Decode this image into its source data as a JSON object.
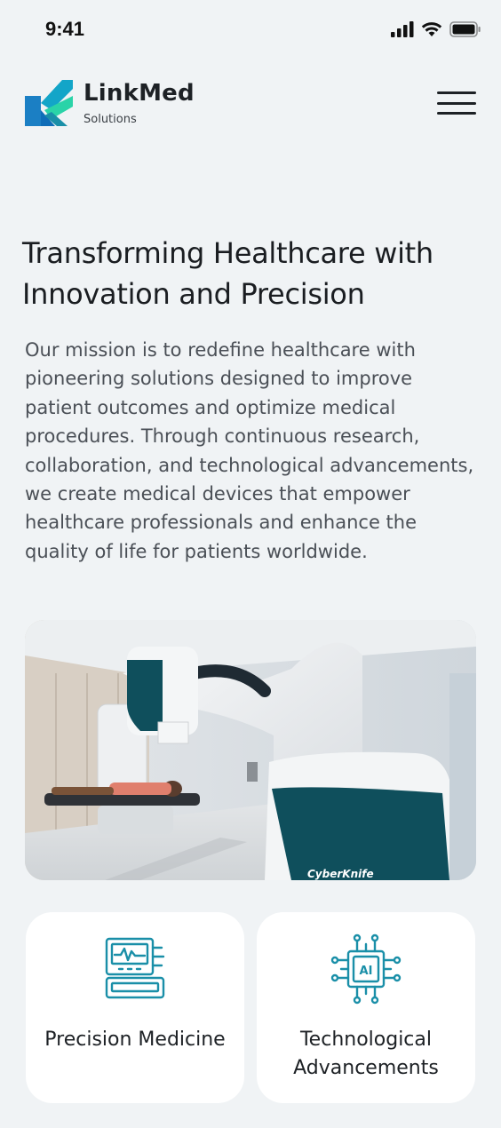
{
  "status_bar": {
    "time": "9:41"
  },
  "header": {
    "brand_name": "LinkMed",
    "brand_sub": "Solutions"
  },
  "hero": {
    "title": "Transforming Healthcare with Innovation and Precision",
    "body": "Our mission is to redefine healthcare with pioneering solutions designed to improve patient outcomes and optimize medical procedures. Through continuous research, collaboration, and technological advancements, we create medical devices that empower healthcare professionals and enhance the quality of life for patients worldwide.",
    "image_caption_text": "CyberKnife"
  },
  "cards": [
    {
      "label": "Precision Medicine",
      "icon": "medical-monitor-icon"
    },
    {
      "label": "Technological Advancements",
      "icon": "ai-chip-icon"
    }
  ],
  "colors": {
    "background": "#f0f3f5",
    "accent_teal": "#1a8fa8",
    "logo_blue": "#0f6db8",
    "logo_green": "#2ad3a8",
    "text_dark": "#1a1d21",
    "text_body": "#4a4f56"
  }
}
